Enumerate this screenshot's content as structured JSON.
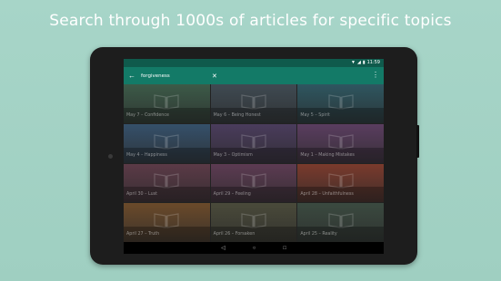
{
  "headline": "Search through 1000s of articles for specific topics",
  "status_bar": {
    "time": "11:59",
    "wifi_icon": "wifi-icon",
    "signal_icon": "signal-icon",
    "battery_icon": "battery-icon"
  },
  "toolbar": {
    "back_icon": "arrow-back-icon",
    "query": "forgiveness",
    "clear_icon": "close-icon",
    "more_icon": "more-vertical-icon"
  },
  "colors": {
    "background": "#a7d5c8",
    "toolbar": "#137a67",
    "status_bar": "#0f5a4c"
  },
  "results": [
    {
      "title": "May 7 – Confidence",
      "color": "#3c5a48"
    },
    {
      "title": "May 6 – Being Honest",
      "color": "#3f4a52"
    },
    {
      "title": "May 5 – Spirit",
      "color": "#2e5660"
    },
    {
      "title": "May 4 – Happiness",
      "color": "#35506a"
    },
    {
      "title": "May 3 – Optimism",
      "color": "#4a3c5c"
    },
    {
      "title": "May 1 – Making Mistakes",
      "color": "#5a3d5f"
    },
    {
      "title": "April 30 – Lust",
      "color": "#5b3a47"
    },
    {
      "title": "April 29 – Feeling",
      "color": "#5c3b52"
    },
    {
      "title": "April 28 – Unfaithfulness",
      "color": "#7a3a2c"
    },
    {
      "title": "April 27 – Truth",
      "color": "#6b4a2a"
    },
    {
      "title": "April 26 – Forsaken",
      "color": "#4a4a3a"
    },
    {
      "title": "April 25 – Reality",
      "color": "#3b4a40"
    }
  ],
  "navigation": {
    "back_icon": "nav-back-icon",
    "home_icon": "nav-home-icon",
    "recents_icon": "nav-recents-icon"
  }
}
